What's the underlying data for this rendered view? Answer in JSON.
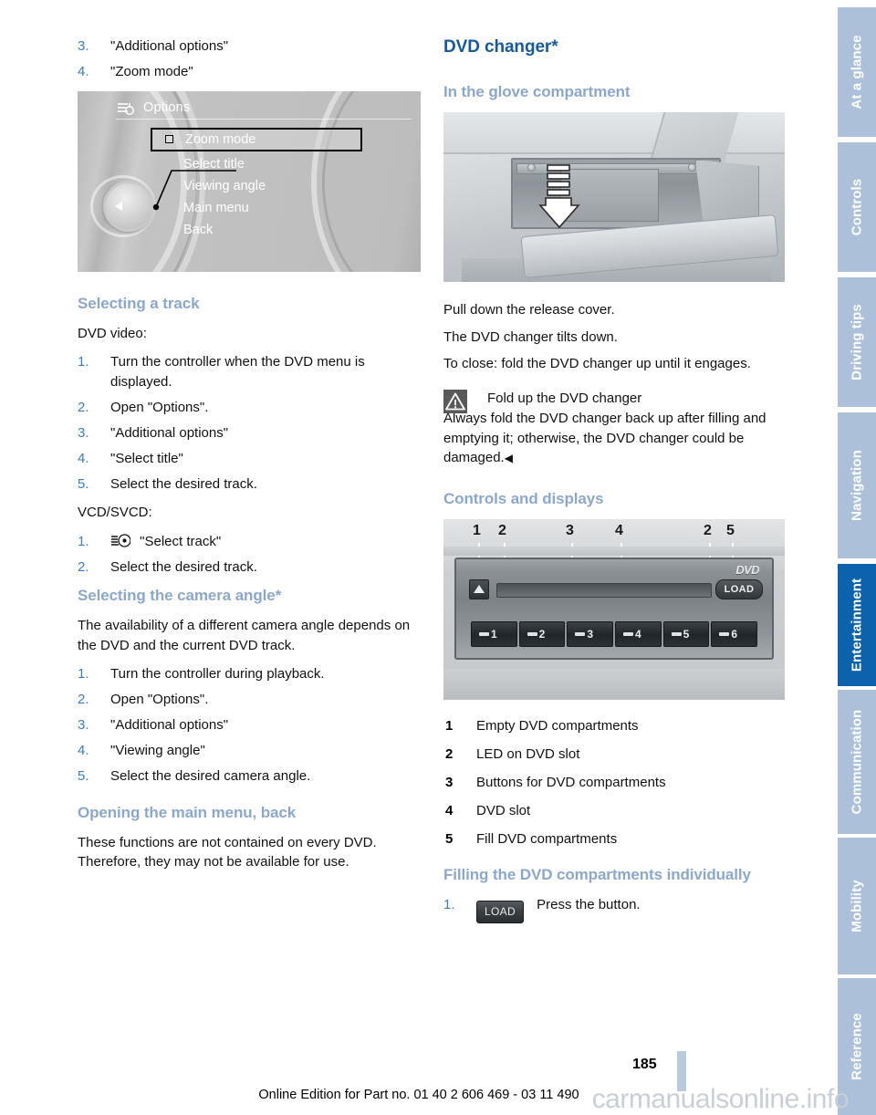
{
  "document": {
    "page_number": "185",
    "footer_line": "Online Edition for Part no. 01 40 2 606 469 - 03 11 490",
    "watermark": "carmanualsonline.info"
  },
  "colors": {
    "h1_blue": "#15599e",
    "h2_blue": "#8ba8cc",
    "list_number_blue": "#3a7fc1",
    "tab_inactive": "#adc0da",
    "tab_active": "#0b62ad",
    "page_bar": "#b9c9de",
    "watermark": "#c8cfd6"
  },
  "tabs": [
    {
      "label": "At a glance",
      "active": false
    },
    {
      "label": "Controls",
      "active": false
    },
    {
      "label": "Driving tips",
      "active": false
    },
    {
      "label": "Navigation",
      "active": false
    },
    {
      "label": "Entertainment",
      "active": true
    },
    {
      "label": "Communication",
      "active": false
    },
    {
      "label": "Mobility",
      "active": false
    },
    {
      "label": "Reference",
      "active": false
    }
  ],
  "left_column": {
    "top_steps": [
      {
        "num": "3.",
        "text": "\"Additional options\""
      },
      {
        "num": "4.",
        "text": "\"Zoom mode\""
      }
    ],
    "idrive_figure": {
      "name": "idrive-options-menu",
      "header_label": "Options",
      "header_icon": "options-entertainment-icon",
      "items": [
        {
          "label": "Zoom mode",
          "selected": true,
          "checkbox": true
        },
        {
          "label": "Select title",
          "selected": false,
          "checkbox": false
        },
        {
          "label": "Viewing angle",
          "selected": false,
          "checkbox": false
        },
        {
          "label": "Main menu",
          "selected": false,
          "checkbox": false
        },
        {
          "label": "Back",
          "selected": false,
          "checkbox": false
        }
      ]
    },
    "selecting_track": {
      "heading": "Selecting a track",
      "lead": "DVD video:",
      "steps": [
        {
          "num": "1.",
          "text": "Turn the controller when the DVD menu is displayed."
        },
        {
          "num": "2.",
          "text": "Open \"Options\"."
        },
        {
          "num": "3.",
          "text": "\"Additional options\""
        },
        {
          "num": "4.",
          "text": "\"Select title\""
        },
        {
          "num": "5.",
          "text": "Select the desired track."
        }
      ],
      "second_lead": "VCD/SVCD:",
      "second_steps": [
        {
          "num": "1.",
          "icon": "select-track-icon",
          "text": "\"Select track\""
        },
        {
          "num": "2.",
          "text": "Select the desired track."
        }
      ]
    },
    "camera_angle": {
      "heading": "Selecting the camera angle*",
      "body": "The availability of a different camera angle depends on the DVD and the current DVD track.",
      "steps": [
        {
          "num": "1.",
          "text": "Turn the controller during playback."
        },
        {
          "num": "2.",
          "text": "Open \"Options\"."
        },
        {
          "num": "3.",
          "text": "\"Additional options\""
        },
        {
          "num": "4.",
          "text": "\"Viewing angle\""
        },
        {
          "num": "5.",
          "text": "Select the desired camera angle."
        }
      ]
    },
    "main_menu_back": {
      "heading": "Opening the main menu, back",
      "body": "These functions are not contained on every DVD. Therefore, they may not be available for use."
    }
  },
  "right_column": {
    "title": "DVD changer*",
    "glove_compartment": {
      "heading": "In the glove compartment",
      "figure_name": "glove-compartment-dvd-changer-photo",
      "lines": [
        "Pull down the release cover.",
        "The DVD changer tilts down.",
        "To close: fold the DVD changer up until it engages."
      ]
    },
    "warning": {
      "icon": "warning-triangle-icon",
      "title": "Fold up the DVD changer",
      "text": "Always fold the DVD changer back up after filling and emptying it; otherwise, the DVD changer could be damaged.",
      "end_mark": "◀"
    },
    "controls_displays": {
      "heading": "Controls and displays",
      "figure_name": "dvd-changer-front-panel-photo",
      "figure_callouts": [
        "1",
        "2",
        "3",
        "4",
        "2",
        "5"
      ],
      "figure_buttons": [
        "1",
        "2",
        "3",
        "4",
        "5",
        "6"
      ],
      "figure_load_label": "LOAD",
      "figure_dvd_logo": "DVD",
      "legend": [
        {
          "num": "1",
          "text": "Empty DVD compartments"
        },
        {
          "num": "2",
          "text": "LED on DVD slot"
        },
        {
          "num": "3",
          "text": "Buttons for DVD compartments"
        },
        {
          "num": "4",
          "text": "DVD slot"
        },
        {
          "num": "5",
          "text": "Fill DVD compartments"
        }
      ]
    },
    "filling": {
      "heading": "Filling the DVD compartments individually",
      "steps": [
        {
          "num": "1.",
          "button_label": "LOAD",
          "text": "Press the button."
        }
      ]
    }
  }
}
